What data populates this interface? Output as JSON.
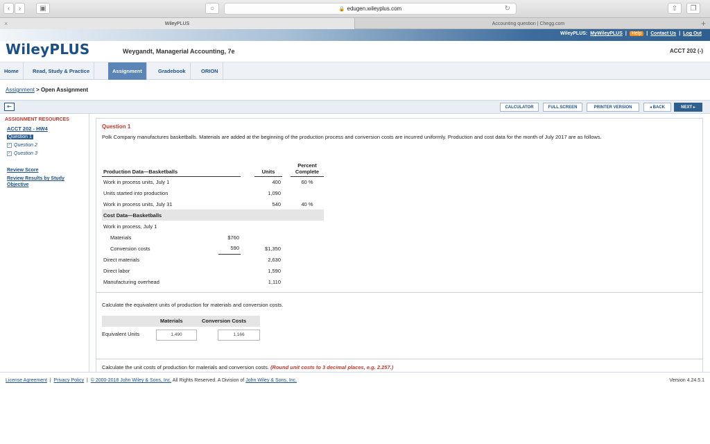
{
  "browser": {
    "url": "edugen.wileyplus.com",
    "tabs": [
      {
        "label": "WileyPLUS"
      },
      {
        "label": "Accounting question | Chegg.com"
      }
    ]
  },
  "header": {
    "links": {
      "wileyplus": "WileyPLUS:",
      "mywileyplus": "MyWileyPLUS",
      "help": "Help",
      "contact": "Contact Us",
      "logout": "Log Out"
    },
    "logo": "WileyPLUS",
    "book_title": "Weygandt, Managerial Accounting, 7e",
    "course": "ACCT 202 (-)"
  },
  "nav": {
    "items": [
      "Home",
      "Read, Study & Practice",
      "Assignment",
      "Gradebook",
      "ORION"
    ],
    "active": "Assignment"
  },
  "breadcrumb": {
    "parent": "Assignment",
    "sep": ">",
    "current": "Open Assignment"
  },
  "actions": {
    "calculator": "CALCULATOR",
    "fullscreen": "FULL SCREEN",
    "printer": "PRINTER VERSION",
    "back": "◂ BACK",
    "next": "NEXT ▸"
  },
  "sidebar": {
    "title": "ASSIGNMENT RESOURCES",
    "course": "ACCT 202 - HW4",
    "questions": [
      "Question 1",
      "Question 2",
      "Question 3"
    ],
    "review_score": "Review Score",
    "review_results": "Review Results by Study Objective"
  },
  "question": {
    "title": "Question 1",
    "text": "Polk Company manufactures basketballs. Materials are added at the beginning of the production process and conversion costs are incurred uniformly. Production and cost data for the month of July 2017 are as follows.",
    "table": {
      "production_header": "Production Data—Basketballs",
      "units_header": "Units",
      "percent_header": "Percent Complete",
      "wip_july1_label": "Work in process units, July 1",
      "wip_july1_units": "400",
      "wip_july1_pct": "60 %",
      "started_label": "Units started into production",
      "started_units": "1,090",
      "wip_july31_label": "Work in process units, July 31",
      "wip_july31_units": "540",
      "wip_july31_pct": "40 %",
      "cost_header": "Cost Data—Basketballs",
      "wip_cost_label": "Work in process, July 1",
      "materials_label": "Materials",
      "materials_value": "$760",
      "conversion_label": "Conversion costs",
      "conversion_value": "590",
      "wip_total": "$1,350",
      "direct_materials_label": "Direct materials",
      "direct_materials_value": "2,630",
      "direct_labor_label": "Direct labor",
      "direct_labor_value": "1,590",
      "overhead_label": "Manufacturing overhead",
      "overhead_value": "1,110"
    },
    "prompt1": "Calculate the equivalent units of production for materials and conversion costs.",
    "eq_materials_header": "Materials",
    "eq_conversion_header": "Conversion Costs",
    "eq_label": "Equivalent Units",
    "eq_materials_value": "1,490",
    "eq_conversion_value": "1,166",
    "prompt2": "Calculate the unit costs of production for materials and conversion costs.",
    "prompt2_note": "(Round unit costs to 3 decimal places, e.g. 2.257.)"
  },
  "footer": {
    "license": "License Agreement",
    "privacy": "Privacy Policy",
    "copyright": "© 2000-2018 John Wiley & Sons, Inc.",
    "rights": "All Rights Reserved. A Division of",
    "company": "John Wiley & Sons, Inc.",
    "version": "Version 4.24.5.1"
  }
}
